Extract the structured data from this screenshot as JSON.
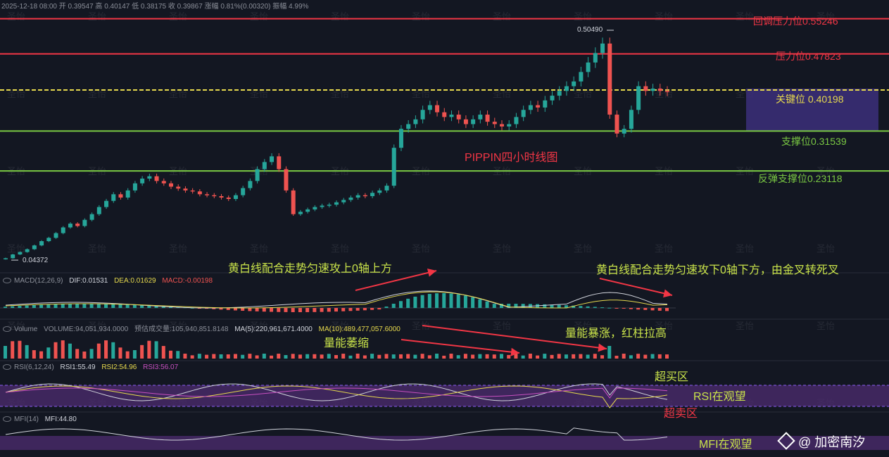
{
  "header": {
    "ohlc_line": "2025-12-18 08:00  开 0.39547  高 0.40147  低 0.38175  收 0.39867  涨幅 0.81%(0.00320)  振幅 4.99%"
  },
  "watermark": "圣怡",
  "title": "PIPPIN四小时线图",
  "price_markers": {
    "high": "0.50490",
    "low": "0.04372"
  },
  "levels": [
    {
      "label": "回调压力位0.55246",
      "price": 0.55246,
      "color": "#f23645"
    },
    {
      "label": "压力位0.47823",
      "price": 0.47823,
      "color": "#f23645"
    },
    {
      "label": "关键位 0.40198",
      "price": 0.40198,
      "color": "#e6d94d"
    },
    {
      "label": "支撑位0.31539",
      "price": 0.31539,
      "color": "#7ac943"
    },
    {
      "label": "反弹支撑位0.23118",
      "price": 0.23118,
      "color": "#7ac943"
    }
  ],
  "macd": {
    "name": "MACD(12,26,9)",
    "dif": "DIF:0.01531",
    "dea": "DEA:0.01629",
    "macd": "MACD:-0.00198"
  },
  "volume": {
    "name": "Volume",
    "volume": "VOLUME:94,051,934.0000",
    "est": "预估成交量:105,940,851.8148",
    "ma5": "MA(5):220,961,671.4000",
    "ma10": "MA(10):489,477,057.6000"
  },
  "rsi": {
    "name": "RSI(6,12,24)",
    "rsi1": "RSI1:55.49",
    "rsi2": "RSI2:54.96",
    "rsi3": "RSI3:56.07"
  },
  "mfi": {
    "name": "MFI(14)",
    "mfi": "MFI:44.80"
  },
  "annotations": {
    "macd_left": "黄白线配合走势匀速攻上0轴上方",
    "macd_right": "黄白线配合走势匀速攻下0轴下方，由金叉转死叉",
    "vol_left": "量能萎缩",
    "vol_right": "量能暴涨，红柱拉高",
    "overbought": "超买区",
    "rsi_watch": "RSI在观望",
    "oversold": "超卖区",
    "mfi_watch": "MFI在观望"
  },
  "footer": {
    "brand": "@ 加密南汐"
  },
  "colors": {
    "up": "#26a69a",
    "down": "#ef5350",
    "yellow": "#e6d94d",
    "green": "#7ac943",
    "red": "#f23645",
    "purple": "#4a2a6b",
    "key_box": "#3c2f7a"
  },
  "chart_data": {
    "type": "candlestick",
    "title": "PIPPIN四小时线图",
    "ylim": [
      0.04,
      0.58
    ],
    "horizontal_levels": [
      0.55246,
      0.47823,
      0.40198,
      0.31539,
      0.23118
    ],
    "close": [
      0.047,
      0.055,
      0.06,
      0.066,
      0.074,
      0.083,
      0.09,
      0.1,
      0.112,
      0.12,
      0.115,
      0.128,
      0.14,
      0.155,
      0.168,
      0.182,
      0.175,
      0.19,
      0.205,
      0.215,
      0.22,
      0.21,
      0.205,
      0.198,
      0.194,
      0.19,
      0.188,
      0.182,
      0.18,
      0.178,
      0.175,
      0.172,
      0.18,
      0.195,
      0.21,
      0.235,
      0.25,
      0.262,
      0.235,
      0.19,
      0.14,
      0.145,
      0.15,
      0.155,
      0.158,
      0.16,
      0.165,
      0.17,
      0.175,
      0.18,
      0.178,
      0.185,
      0.19,
      0.2,
      0.28,
      0.32,
      0.33,
      0.34,
      0.36,
      0.37,
      0.355,
      0.345,
      0.35,
      0.34,
      0.33,
      0.34,
      0.35,
      0.335,
      0.33,
      0.325,
      0.33,
      0.345,
      0.36,
      0.37,
      0.365,
      0.38,
      0.39,
      0.4,
      0.41,
      0.42,
      0.44,
      0.46,
      0.48,
      0.5,
      0.35,
      0.31,
      0.32,
      0.36,
      0.41,
      0.4,
      0.405,
      0.4,
      0.399
    ]
  }
}
